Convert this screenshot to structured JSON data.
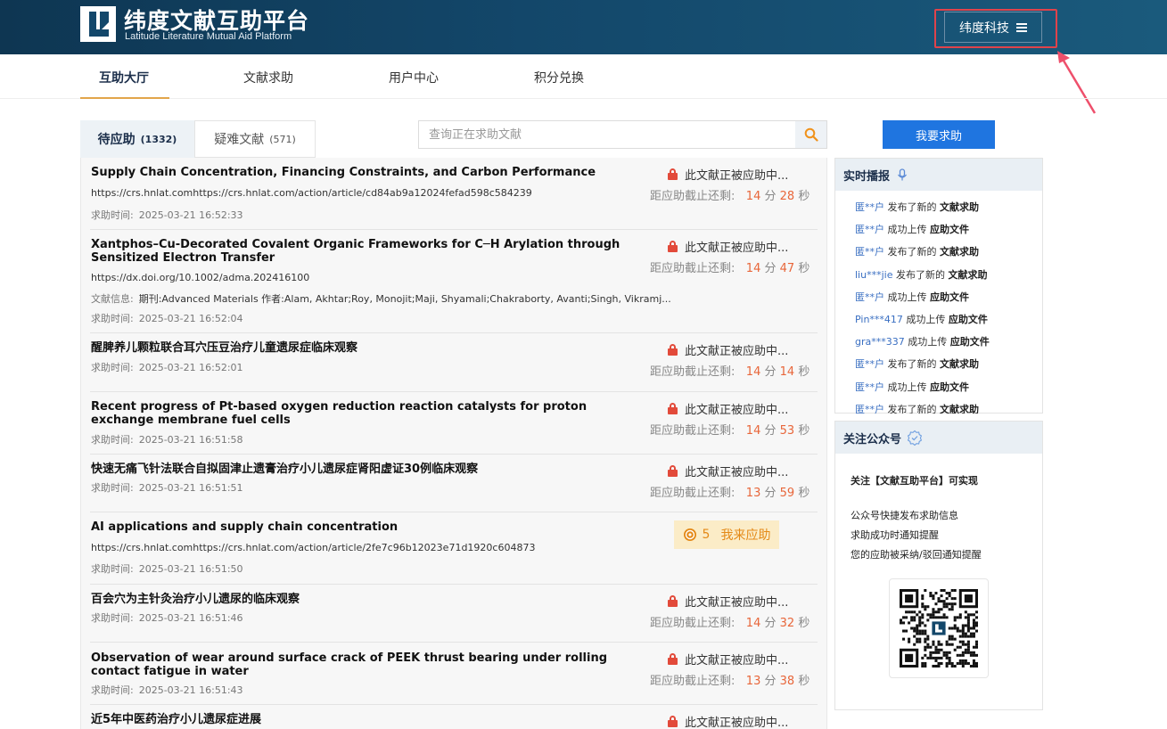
{
  "header": {
    "title": "纬度文献互助平台",
    "subtitle": "Latitude Literature Mutual Aid Platform",
    "user_button": "纬度科技"
  },
  "nav": {
    "items": [
      {
        "label": "互助大厅"
      },
      {
        "label": "文献求助"
      },
      {
        "label": "用户中心"
      },
      {
        "label": "积分兑换"
      }
    ]
  },
  "tabs": {
    "pending": {
      "label": "待应助",
      "count": "(1332)"
    },
    "difficult": {
      "label": "疑难文献",
      "count": "(571)"
    }
  },
  "search": {
    "placeholder": "查询正在求助文献"
  },
  "labels": {
    "status_in_progress": "此文献正被应助中...",
    "deadline": "距应助截止还剩:",
    "min": "分",
    "sec": "秒",
    "request_time": "求助时间:",
    "doc_info": "文献信息:",
    "respond": "我来应助"
  },
  "items": [
    {
      "title": "Supply Chain Concentration, Financing Constraints, and Carbon Performance",
      "url": "https://crs.hnlat.comhttps://crs.hnlat.com/action/article/cd84ab9a12024fefad598c584239",
      "time": "2025-03-21 16:52:33",
      "minutes": "14",
      "seconds": "28"
    },
    {
      "title": "Xantphos–Cu-Decorated Covalent Organic Frameworks for C─H Arylation through Sensitized Electron Transfer",
      "url": "https://dx.doi.org/10.1002/adma.202416100",
      "info": "期刊:Advanced Materials 作者:Alam, Akhtar;Roy, Monojit;Maji, Shyamali;Chakraborty, Avanti;Singh, Vikramj...",
      "time": "2025-03-21 16:52:04",
      "minutes": "14",
      "seconds": "47"
    },
    {
      "title": "醒脾养儿颗粒联合耳穴压豆治疗儿童遗尿症临床观察",
      "time": "2025-03-21 16:52:01",
      "minutes": "14",
      "seconds": "14"
    },
    {
      "title": "Recent progress of Pt-based oxygen reduction reaction catalysts for proton exchange membrane fuel cells",
      "time": "2025-03-21 16:51:58",
      "minutes": "14",
      "seconds": "53"
    },
    {
      "title": "快速无痛飞针法联合自拟固津止遗膏治疗小儿遗尿症肾阳虚证30例临床观察",
      "time": "2025-03-21 16:51:51",
      "minutes": "13",
      "seconds": "59"
    },
    {
      "title": "AI applications and supply chain concentration",
      "url": "https://crs.hnlat.comhttps://crs.hnlat.com/action/article/2fe7c96b12023e71d1920c604873",
      "time": "2025-03-21 16:51:50",
      "points": "5"
    },
    {
      "title": "百会穴为主针灸治疗小儿遗尿的临床观察",
      "time": "2025-03-21 16:51:46",
      "minutes": "14",
      "seconds": "32"
    },
    {
      "title": "Observation of wear around surface crack of PEEK thrust bearing under rolling contact fatigue in water",
      "time": "2025-03-21 16:51:43",
      "minutes": "13",
      "seconds": "38"
    },
    {
      "title": "近5年中医药治疗小儿遗尿症进展"
    }
  ],
  "sidebar": {
    "help_button": "我要求助",
    "broadcast_title": "实时播报",
    "broadcast": [
      {
        "user": "匿**户",
        "action": "发布了新的",
        "target": "文献求助"
      },
      {
        "user": "匿**户",
        "action": "成功上传",
        "target": "应助文件"
      },
      {
        "user": "匿**户",
        "action": "发布了新的",
        "target": "文献求助"
      },
      {
        "user": "liu***jie",
        "action": "发布了新的",
        "target": "文献求助"
      },
      {
        "user": "匿**户",
        "action": "成功上传",
        "target": "应助文件"
      },
      {
        "user": "Pin***417",
        "action": "成功上传",
        "target": "应助文件"
      },
      {
        "user": "gra***337",
        "action": "成功上传",
        "target": "应助文件"
      },
      {
        "user": "匿**户",
        "action": "发布了新的",
        "target": "文献求助"
      },
      {
        "user": "匿**户",
        "action": "成功上传",
        "target": "应助文件"
      },
      {
        "user": "匿**户",
        "action": "发布了新的",
        "target": "文献求助"
      }
    ],
    "follow_title": "关注公众号",
    "follow_heading": "关注【文献互助平台】可实现",
    "follow_lines": [
      "公众号快捷发布求助信息",
      "求助成功时通知提醒",
      "您的应助被采纳/驳回通知提醒"
    ]
  },
  "colors": {
    "header_bg": "#13476a",
    "accent_blue": "#1f75e0",
    "countdown": "#e8663a",
    "lock": "#e24a3a",
    "highlight": "#e0434b"
  }
}
